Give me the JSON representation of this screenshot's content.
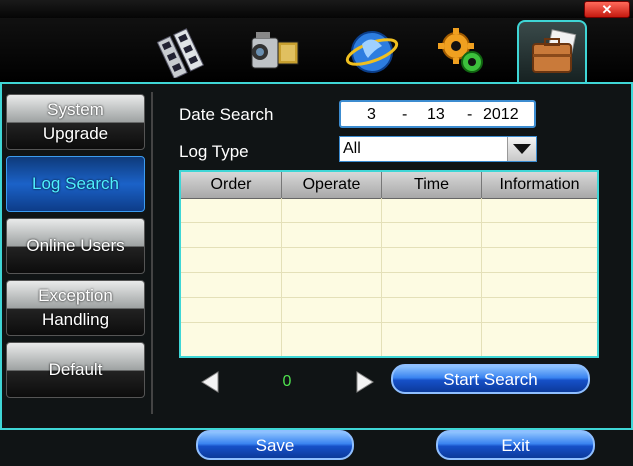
{
  "titlebar": {
    "close_glyph": "✕"
  },
  "top_tabs": [
    {
      "id": "playback",
      "icon": "film-icon"
    },
    {
      "id": "record",
      "icon": "camcorder-icon"
    },
    {
      "id": "network",
      "icon": "network-globe-icon"
    },
    {
      "id": "settings",
      "icon": "gears-icon"
    },
    {
      "id": "advanced",
      "icon": "briefcase-icon",
      "active": true
    }
  ],
  "sidebar": {
    "items": [
      {
        "label_line1": "System",
        "label_line2": "Upgrade"
      },
      {
        "label": "Log Search",
        "active": true
      },
      {
        "label": "Online Users"
      },
      {
        "label_line1": "Exception",
        "label_line2": "Handling"
      },
      {
        "label": "Default"
      }
    ]
  },
  "form": {
    "date_label": "Date Search",
    "date": {
      "month": "3",
      "sep1": "-",
      "day": "13",
      "sep2": "-",
      "year": "2012"
    },
    "log_type_label": "Log Type",
    "log_type_value": "All"
  },
  "table": {
    "columns": [
      "Order",
      "Operate",
      "Time",
      "Information"
    ],
    "rows": []
  },
  "pagination": {
    "page": "0"
  },
  "buttons": {
    "start_search": "Start Search",
    "save": "Save",
    "exit": "Exit"
  },
  "colors": {
    "accent": "#3fd6d6",
    "active_blue": "#1b62c8",
    "page_number": "#4fe24f"
  }
}
